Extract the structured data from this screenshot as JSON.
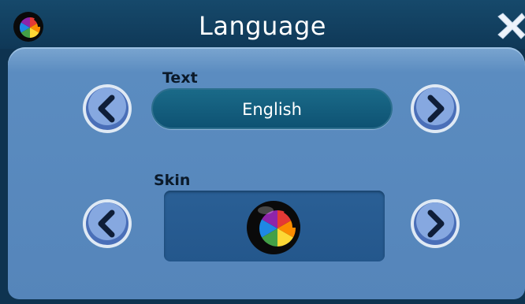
{
  "window": {
    "title": "Language"
  },
  "text_setting": {
    "label": "Text",
    "value": "English"
  },
  "skin_setting": {
    "label": "Skin"
  },
  "icons": {
    "app": "color-wheel-icon",
    "close": "close-icon",
    "prev": "chevron-left-icon",
    "next": "chevron-right-icon",
    "skin": "color-wheel-icon"
  },
  "colors": {
    "titlebar": "#0f3857",
    "panel": "#5585ba",
    "field": "#0e5273",
    "skin_box": "#24578c"
  }
}
